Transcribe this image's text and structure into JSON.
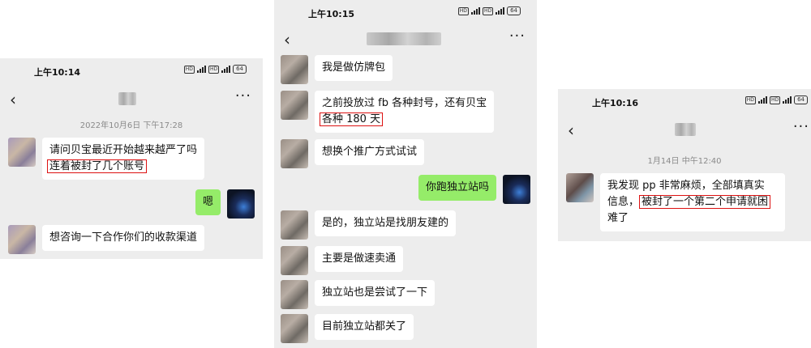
{
  "panel1": {
    "time": "上午10:14",
    "battery": "64",
    "date": "2022年10月6日 下午17:28",
    "messages": [
      {
        "line1": "请问贝宝最近开始越来越严了吗",
        "line2": "连着被封了几个账号"
      },
      {
        "text": "嗯"
      },
      {
        "text": "想咨询一下合作你们的收款渠道"
      }
    ]
  },
  "panel2": {
    "time": "上午10:15",
    "battery": "64",
    "messages": [
      {
        "text": "我是做仿牌包"
      },
      {
        "line1": "之前投放过 fb 各种封号，还有贝宝",
        "line2": "各种 180 天"
      },
      {
        "text": "想换个推广方式试试"
      },
      {
        "text": "你跑独立站吗"
      },
      {
        "text": "是的，独立站是找朋友建的"
      },
      {
        "text": "主要是做速卖通"
      },
      {
        "text": "独立站也是尝试了一下"
      },
      {
        "text": "目前独立站都关了"
      }
    ]
  },
  "panel3": {
    "time": "上午10:16",
    "battery": "64",
    "date": "1月14日 中午12:40",
    "message": {
      "line1": "我发现 pp 非常麻烦，全部填真实",
      "line2a": "信息，",
      "line2b": "被封了一个第二个申请就困",
      "line3": "难了"
    }
  },
  "icons": {
    "back": "back-arrow-icon",
    "more": "more-options-icon",
    "highlight_color": "#dd1111",
    "me_bubble_color": "#95ec69"
  }
}
